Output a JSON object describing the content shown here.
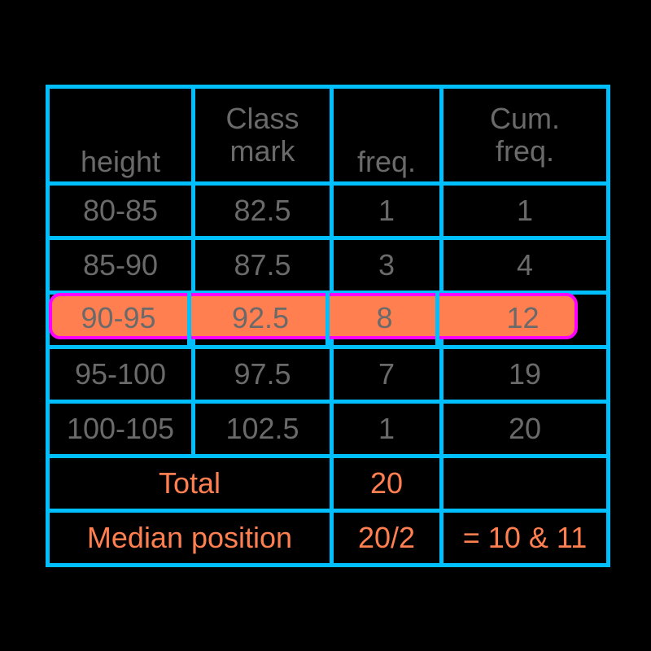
{
  "colors": {
    "background": "#000000",
    "border": "#00bfff",
    "text": "#6a6a6a",
    "accent": "#ff7f50",
    "highlight_fill": "#ff7f50",
    "highlight_stroke": "#ff00ff"
  },
  "table": {
    "headers": [
      "height",
      "Class mark",
      "freq.",
      "Cum. freq."
    ],
    "header_cells": {
      "height": "height",
      "class_mark_line1": "Class",
      "class_mark_line2": "mark",
      "freq": "freq.",
      "cum_freq_line1": "Cum.",
      "cum_freq_line2": "freq."
    },
    "rows": [
      {
        "height": "80-85",
        "class_mark": "82.5",
        "freq": "1",
        "cum_freq": "1",
        "highlighted": false
      },
      {
        "height": "85-90",
        "class_mark": "87.5",
        "freq": "3",
        "cum_freq": "4",
        "highlighted": false
      },
      {
        "height": "90-95",
        "class_mark": "92.5",
        "freq": "8",
        "cum_freq": "12",
        "highlighted": true
      },
      {
        "height": "95-100",
        "class_mark": "97.5",
        "freq": "7",
        "cum_freq": "19",
        "highlighted": false
      },
      {
        "height": "100-105",
        "class_mark": "102.5",
        "freq": "1",
        "cum_freq": "20",
        "highlighted": false
      }
    ],
    "total_row": {
      "label": "Total",
      "freq": "20",
      "cum_freq": ""
    },
    "median_row": {
      "label": "Median position",
      "expression": "20/2",
      "result": "= 10 & 11"
    }
  },
  "chart_data": {
    "type": "table",
    "title": "Grouped frequency distribution with cumulative frequency and median position",
    "columns": [
      "height",
      "Class mark",
      "freq.",
      "Cum. freq."
    ],
    "categories": [
      "80-85",
      "85-90",
      "90-95",
      "95-100",
      "100-105"
    ],
    "series": [
      {
        "name": "Class mark",
        "values": [
          82.5,
          87.5,
          92.5,
          97.5,
          102.5
        ]
      },
      {
        "name": "freq.",
        "values": [
          1,
          3,
          8,
          7,
          1
        ]
      },
      {
        "name": "Cum. freq.",
        "values": [
          1,
          4,
          12,
          19,
          20
        ]
      }
    ],
    "total_frequency": 20,
    "median_position_expression": "20/2",
    "median_positions": "= 10 & 11",
    "highlighted_class": "90-95",
    "xlabel": "height",
    "ylabel": "",
    "grid": true,
    "legend": "none"
  }
}
